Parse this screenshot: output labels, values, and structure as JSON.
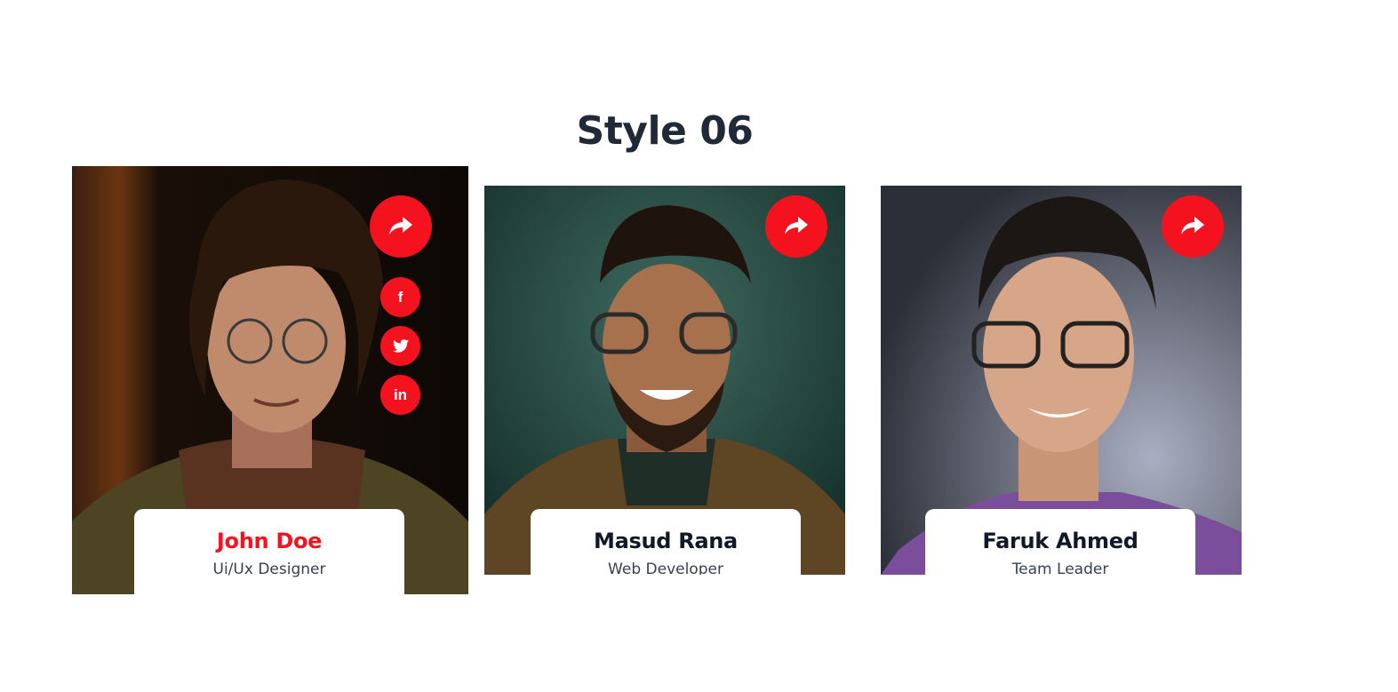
{
  "section": {
    "title": "Style 06"
  },
  "theme": {
    "accent": "#f5121f",
    "heading": "#1f2937",
    "text": "#374151"
  },
  "team": [
    {
      "name": "John Doe",
      "role": "Ui/Ux Designer",
      "active": true,
      "share_icon": "share-icon",
      "socials": [
        {
          "icon": "facebook-icon",
          "glyph": "f"
        },
        {
          "icon": "twitter-icon",
          "glyph": "🐦"
        },
        {
          "icon": "linkedin-icon",
          "glyph": "in"
        }
      ]
    },
    {
      "name": "Masud Rana",
      "role": "Web Developer",
      "active": false,
      "share_icon": "share-icon"
    },
    {
      "name": "Faruk Ahmed",
      "role": "Team Leader",
      "active": false,
      "share_icon": "share-icon"
    }
  ]
}
